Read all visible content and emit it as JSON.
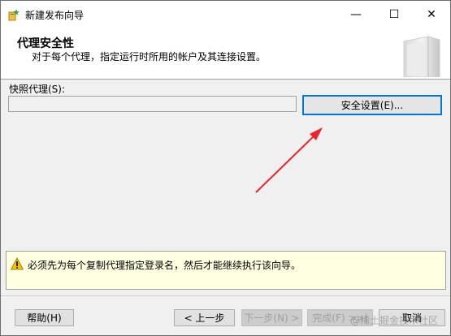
{
  "window": {
    "title": "新建发布向导",
    "controls": {
      "minimize": "—",
      "maximize": "☐",
      "close": "✕"
    }
  },
  "header": {
    "title": "代理安全性",
    "description": "对于每个代理，指定运行时所用的帐户及其连接设置。",
    "graphic_icon": "wizard-banner-icon"
  },
  "snapshot_agent": {
    "label": "快照代理(S):",
    "value": "",
    "security_button": "安全设置(E)..."
  },
  "message": {
    "icon": "warning-icon",
    "text": "必须先为每个复制代理指定登录名，然后才能继续执行该向导。"
  },
  "footer": {
    "help": "帮助(H)",
    "back": "< 上一步",
    "next": "下一步(N) >",
    "finish": "完成(F) >>|",
    "cancel": "取消"
  },
  "watermark": "@稀土掘金技术社区",
  "colors": {
    "accent": "#0078d7",
    "annotation_arrow": "#e8262d",
    "message_bg": "#ffffe1"
  }
}
